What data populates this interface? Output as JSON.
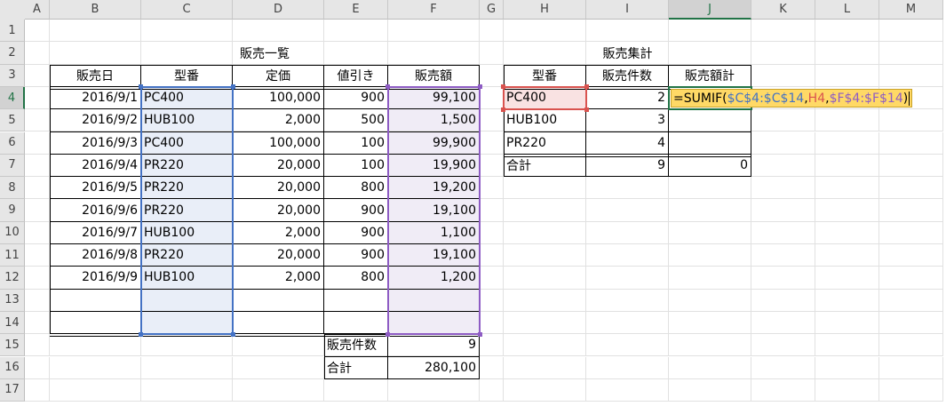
{
  "columns": [
    "A",
    "B",
    "C",
    "D",
    "E",
    "F",
    "G",
    "H",
    "I",
    "J",
    "K",
    "L",
    "M"
  ],
  "rows": [
    "1",
    "2",
    "3",
    "4",
    "5",
    "6",
    "7",
    "8",
    "9",
    "10",
    "11",
    "12",
    "13",
    "14",
    "15",
    "16",
    "17"
  ],
  "active_column": "J",
  "active_row": "4",
  "titles": {
    "sales_list": "販売一覧",
    "sales_summary": "販売集計"
  },
  "table1": {
    "headers": [
      "販売日",
      "型番",
      "定価",
      "値引き",
      "販売額"
    ],
    "rows": [
      [
        "2016/9/1",
        "PC400",
        "100,000",
        "900",
        "99,100"
      ],
      [
        "2016/9/2",
        "HUB100",
        "2,000",
        "500",
        "1,500"
      ],
      [
        "2016/9/3",
        "PC400",
        "100,000",
        "100",
        "99,900"
      ],
      [
        "2016/9/4",
        "PR220",
        "20,000",
        "100",
        "19,900"
      ],
      [
        "2016/9/5",
        "PR220",
        "20,000",
        "800",
        "19,200"
      ],
      [
        "2016/9/6",
        "PR220",
        "20,000",
        "900",
        "19,100"
      ],
      [
        "2016/9/7",
        "HUB100",
        "2,000",
        "900",
        "1,100"
      ],
      [
        "2016/9/8",
        "PR220",
        "20,000",
        "900",
        "19,100"
      ],
      [
        "2016/9/9",
        "HUB100",
        "2,000",
        "800",
        "1,200"
      ]
    ],
    "count_label": "販売件数",
    "count_value": "9",
    "total_label": "合計",
    "total_value": "280,100"
  },
  "table2": {
    "headers": [
      "型番",
      "販売件数",
      "販売額計"
    ],
    "rows": [
      [
        "PC400",
        "2"
      ],
      [
        "HUB100",
        "3"
      ],
      [
        "PR220",
        "4"
      ]
    ],
    "total_label": "合計",
    "total_count": "9",
    "total_amount": "0"
  },
  "formula": {
    "prefix": "=SUMIF(",
    "ref1": "$C$4:$C$14",
    "sep1": ",",
    "ref2": "H4",
    "sep2": ", ",
    "ref3": "$F$4:$F$14",
    "suffix": ")"
  },
  "colors": {
    "range_c": "#4472c4",
    "range_c_fill": "#e9eef8",
    "range_h": "#d9534f",
    "range_h_fill": "#f9e2e2",
    "range_f": "#8e5cc4",
    "range_f_fill": "#f0ecf6",
    "formula_bg": "#ffd966",
    "excel_green": "#217346"
  }
}
